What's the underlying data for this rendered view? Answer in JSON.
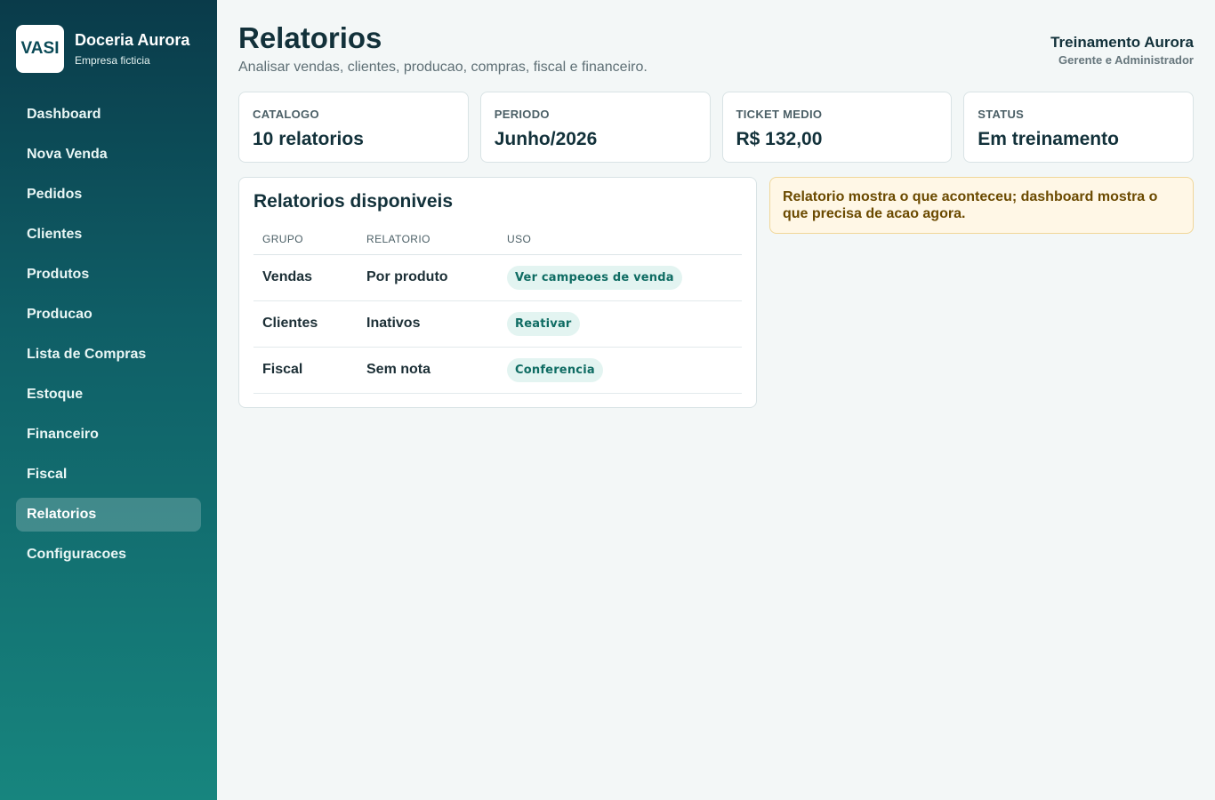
{
  "brand": {
    "logo": "VASI",
    "name": "Doceria Aurora",
    "subtitle": "Empresa ficticia"
  },
  "sidebar": {
    "items": [
      {
        "label": "Dashboard",
        "active": false
      },
      {
        "label": "Nova Venda",
        "active": false
      },
      {
        "label": "Pedidos",
        "active": false
      },
      {
        "label": "Clientes",
        "active": false
      },
      {
        "label": "Produtos",
        "active": false
      },
      {
        "label": "Producao",
        "active": false
      },
      {
        "label": "Lista de Compras",
        "active": false
      },
      {
        "label": "Estoque",
        "active": false
      },
      {
        "label": "Financeiro",
        "active": false
      },
      {
        "label": "Fiscal",
        "active": false
      },
      {
        "label": "Relatorios",
        "active": true
      },
      {
        "label": "Configuracoes",
        "active": false
      }
    ]
  },
  "header": {
    "title": "Relatorios",
    "subtitle": "Analisar vendas, clientes, producao, compras, fiscal e financeiro."
  },
  "user": {
    "name": "Treinamento Aurora",
    "role": "Gerente e Administrador"
  },
  "stats": [
    {
      "label": "CATALOGO",
      "value": "10 relatorios"
    },
    {
      "label": "PERIODO",
      "value": "Junho/2026"
    },
    {
      "label": "TICKET MEDIO",
      "value": "R$ 132,00"
    },
    {
      "label": "STATUS",
      "value": "Em treinamento"
    }
  ],
  "reports": {
    "title": "Relatorios disponiveis",
    "columns": [
      "GRUPO",
      "RELATORIO",
      "USO"
    ],
    "rows": [
      {
        "grupo": "Vendas",
        "relatorio": "Por produto",
        "uso": "Ver campeoes de venda"
      },
      {
        "grupo": "Clientes",
        "relatorio": "Inativos",
        "uso": "Reativar"
      },
      {
        "grupo": "Fiscal",
        "relatorio": "Sem nota",
        "uso": "Conferencia"
      }
    ]
  },
  "note": "Relatorio mostra o que aconteceu; dashboard mostra o que precisa de acao agora.",
  "colors": {
    "sidebar_top": "#0a3b4a",
    "sidebar_bottom": "#17857e",
    "badge_bg": "#e3f4f1",
    "badge_text": "#0f6c63",
    "note_bg": "#fff7e6",
    "note_text": "#6b4a00"
  }
}
